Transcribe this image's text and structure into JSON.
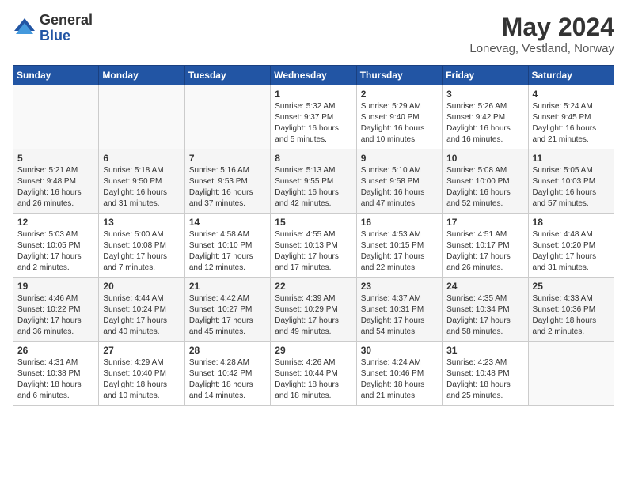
{
  "header": {
    "logo_general": "General",
    "logo_blue": "Blue",
    "main_title": "May 2024",
    "subtitle": "Lonevag, Vestland, Norway"
  },
  "calendar": {
    "headers": [
      "Sunday",
      "Monday",
      "Tuesday",
      "Wednesday",
      "Thursday",
      "Friday",
      "Saturday"
    ],
    "weeks": [
      [
        {
          "day": "",
          "info": ""
        },
        {
          "day": "",
          "info": ""
        },
        {
          "day": "",
          "info": ""
        },
        {
          "day": "1",
          "info": "Sunrise: 5:32 AM\nSunset: 9:37 PM\nDaylight: 16 hours\nand 5 minutes."
        },
        {
          "day": "2",
          "info": "Sunrise: 5:29 AM\nSunset: 9:40 PM\nDaylight: 16 hours\nand 10 minutes."
        },
        {
          "day": "3",
          "info": "Sunrise: 5:26 AM\nSunset: 9:42 PM\nDaylight: 16 hours\nand 16 minutes."
        },
        {
          "day": "4",
          "info": "Sunrise: 5:24 AM\nSunset: 9:45 PM\nDaylight: 16 hours\nand 21 minutes."
        }
      ],
      [
        {
          "day": "5",
          "info": "Sunrise: 5:21 AM\nSunset: 9:48 PM\nDaylight: 16 hours\nand 26 minutes."
        },
        {
          "day": "6",
          "info": "Sunrise: 5:18 AM\nSunset: 9:50 PM\nDaylight: 16 hours\nand 31 minutes."
        },
        {
          "day": "7",
          "info": "Sunrise: 5:16 AM\nSunset: 9:53 PM\nDaylight: 16 hours\nand 37 minutes."
        },
        {
          "day": "8",
          "info": "Sunrise: 5:13 AM\nSunset: 9:55 PM\nDaylight: 16 hours\nand 42 minutes."
        },
        {
          "day": "9",
          "info": "Sunrise: 5:10 AM\nSunset: 9:58 PM\nDaylight: 16 hours\nand 47 minutes."
        },
        {
          "day": "10",
          "info": "Sunrise: 5:08 AM\nSunset: 10:00 PM\nDaylight: 16 hours\nand 52 minutes."
        },
        {
          "day": "11",
          "info": "Sunrise: 5:05 AM\nSunset: 10:03 PM\nDaylight: 16 hours\nand 57 minutes."
        }
      ],
      [
        {
          "day": "12",
          "info": "Sunrise: 5:03 AM\nSunset: 10:05 PM\nDaylight: 17 hours\nand 2 minutes."
        },
        {
          "day": "13",
          "info": "Sunrise: 5:00 AM\nSunset: 10:08 PM\nDaylight: 17 hours\nand 7 minutes."
        },
        {
          "day": "14",
          "info": "Sunrise: 4:58 AM\nSunset: 10:10 PM\nDaylight: 17 hours\nand 12 minutes."
        },
        {
          "day": "15",
          "info": "Sunrise: 4:55 AM\nSunset: 10:13 PM\nDaylight: 17 hours\nand 17 minutes."
        },
        {
          "day": "16",
          "info": "Sunrise: 4:53 AM\nSunset: 10:15 PM\nDaylight: 17 hours\nand 22 minutes."
        },
        {
          "day": "17",
          "info": "Sunrise: 4:51 AM\nSunset: 10:17 PM\nDaylight: 17 hours\nand 26 minutes."
        },
        {
          "day": "18",
          "info": "Sunrise: 4:48 AM\nSunset: 10:20 PM\nDaylight: 17 hours\nand 31 minutes."
        }
      ],
      [
        {
          "day": "19",
          "info": "Sunrise: 4:46 AM\nSunset: 10:22 PM\nDaylight: 17 hours\nand 36 minutes."
        },
        {
          "day": "20",
          "info": "Sunrise: 4:44 AM\nSunset: 10:24 PM\nDaylight: 17 hours\nand 40 minutes."
        },
        {
          "day": "21",
          "info": "Sunrise: 4:42 AM\nSunset: 10:27 PM\nDaylight: 17 hours\nand 45 minutes."
        },
        {
          "day": "22",
          "info": "Sunrise: 4:39 AM\nSunset: 10:29 PM\nDaylight: 17 hours\nand 49 minutes."
        },
        {
          "day": "23",
          "info": "Sunrise: 4:37 AM\nSunset: 10:31 PM\nDaylight: 17 hours\nand 54 minutes."
        },
        {
          "day": "24",
          "info": "Sunrise: 4:35 AM\nSunset: 10:34 PM\nDaylight: 17 hours\nand 58 minutes."
        },
        {
          "day": "25",
          "info": "Sunrise: 4:33 AM\nSunset: 10:36 PM\nDaylight: 18 hours\nand 2 minutes."
        }
      ],
      [
        {
          "day": "26",
          "info": "Sunrise: 4:31 AM\nSunset: 10:38 PM\nDaylight: 18 hours\nand 6 minutes."
        },
        {
          "day": "27",
          "info": "Sunrise: 4:29 AM\nSunset: 10:40 PM\nDaylight: 18 hours\nand 10 minutes."
        },
        {
          "day": "28",
          "info": "Sunrise: 4:28 AM\nSunset: 10:42 PM\nDaylight: 18 hours\nand 14 minutes."
        },
        {
          "day": "29",
          "info": "Sunrise: 4:26 AM\nSunset: 10:44 PM\nDaylight: 18 hours\nand 18 minutes."
        },
        {
          "day": "30",
          "info": "Sunrise: 4:24 AM\nSunset: 10:46 PM\nDaylight: 18 hours\nand 21 minutes."
        },
        {
          "day": "31",
          "info": "Sunrise: 4:23 AM\nSunset: 10:48 PM\nDaylight: 18 hours\nand 25 minutes."
        },
        {
          "day": "",
          "info": ""
        }
      ]
    ]
  }
}
